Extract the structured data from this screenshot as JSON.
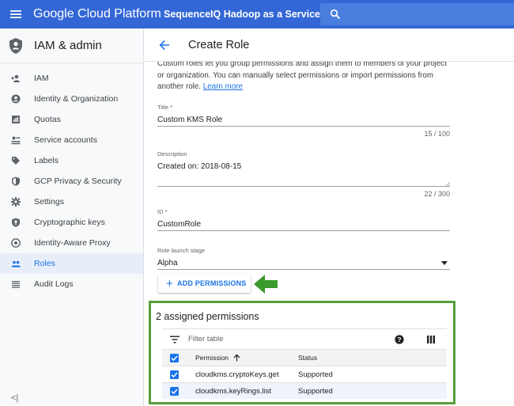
{
  "topbar": {
    "brand": "Google Cloud Platform",
    "project": "SequenceIQ Hadoop as a Service",
    "colors": {
      "bar": "#3367d6",
      "search": "#4a7ede"
    }
  },
  "sidebar": {
    "title": "IAM & admin",
    "items": [
      {
        "label": "IAM",
        "icon": "person-add-icon"
      },
      {
        "label": "Identity & Organization",
        "icon": "account-circle-icon"
      },
      {
        "label": "Quotas",
        "icon": "quota-icon"
      },
      {
        "label": "Service accounts",
        "icon": "service-account-icon"
      },
      {
        "label": "Labels",
        "icon": "label-icon"
      },
      {
        "label": "GCP Privacy & Security",
        "icon": "shield-icon"
      },
      {
        "label": "Settings",
        "icon": "gear-icon"
      },
      {
        "label": "Cryptographic keys",
        "icon": "key-shield-icon"
      },
      {
        "label": "Identity-Aware Proxy",
        "icon": "proxy-icon"
      },
      {
        "label": "Roles",
        "icon": "roles-icon",
        "active": true
      },
      {
        "label": "Audit Logs",
        "icon": "list-icon"
      }
    ],
    "collapse": "<|"
  },
  "page": {
    "title": "Create Role",
    "intro_text": "Custom roles let you group permissions and assign them to members of your project or organization. You can manually select permissions or import permissions from another role.",
    "learn_more": "Learn more"
  },
  "form": {
    "title": {
      "label": "Title *",
      "value": "Custom KMS Role",
      "counter": "15 / 100"
    },
    "description": {
      "label": "Description",
      "value": "Created on: 2018-08-15",
      "counter": "22 / 300"
    },
    "id": {
      "label": "ID *",
      "value": "CustomRole"
    },
    "stage": {
      "label": "Role launch stage",
      "value": "Alpha"
    },
    "add_permissions": "ADD PERMISSIONS"
  },
  "permissions": {
    "title": "2 assigned permissions",
    "filter_placeholder": "Filter table",
    "columns": {
      "permission": "Permission",
      "status": "Status"
    },
    "rows": [
      {
        "permission": "cloudkms.cryptoKeys.get",
        "status": "Supported"
      },
      {
        "permission": "cloudkms.keyRings.list",
        "status": "Supported"
      }
    ],
    "highlight_color": "#56a03a"
  }
}
